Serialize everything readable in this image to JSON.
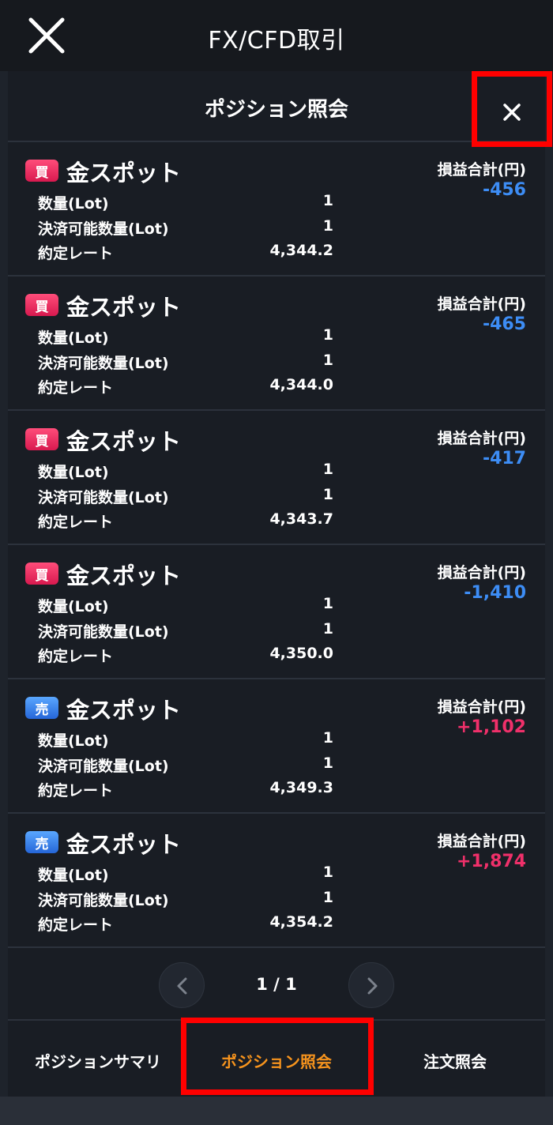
{
  "app": {
    "title": "FX/CFD取引"
  },
  "modal": {
    "title": "ポジション照会"
  },
  "positions": [
    {
      "side": "買",
      "side_type": "buy",
      "instrument": "金スポット",
      "qty_label": "数量(Lot)",
      "qty": "1",
      "settle_label": "決済可能数量(Lot)",
      "settle": "1",
      "rate_label": "約定レート",
      "rate": "4,344.2",
      "pl_label": "損益合計(円)",
      "pl": "-456"
    },
    {
      "side": "買",
      "side_type": "buy",
      "instrument": "金スポット",
      "qty_label": "数量(Lot)",
      "qty": "1",
      "settle_label": "決済可能数量(Lot)",
      "settle": "1",
      "rate_label": "約定レート",
      "rate": "4,344.0",
      "pl_label": "損益合計(円)",
      "pl": "-465"
    },
    {
      "side": "買",
      "side_type": "buy",
      "instrument": "金スポット",
      "qty_label": "数量(Lot)",
      "qty": "1",
      "settle_label": "決済可能数量(Lot)",
      "settle": "1",
      "rate_label": "約定レート",
      "rate": "4,343.7",
      "pl_label": "損益合計(円)",
      "pl": "-417"
    },
    {
      "side": "買",
      "side_type": "buy",
      "instrument": "金スポット",
      "qty_label": "数量(Lot)",
      "qty": "1",
      "settle_label": "決済可能数量(Lot)",
      "settle": "1",
      "rate_label": "約定レート",
      "rate": "4,350.0",
      "pl_label": "損益合計(円)",
      "pl": "-1,410"
    },
    {
      "side": "売",
      "side_type": "sell",
      "instrument": "金スポット",
      "qty_label": "数量(Lot)",
      "qty": "1",
      "settle_label": "決済可能数量(Lot)",
      "settle": "1",
      "rate_label": "約定レート",
      "rate": "4,349.3",
      "pl_label": "損益合計(円)",
      "pl": "+1,102"
    },
    {
      "side": "売",
      "side_type": "sell",
      "instrument": "金スポット",
      "qty_label": "数量(Lot)",
      "qty": "1",
      "settle_label": "決済可能数量(Lot)",
      "settle": "1",
      "rate_label": "約定レート",
      "rate": "4,354.2",
      "pl_label": "損益合計(円)",
      "pl": "+1,874"
    }
  ],
  "pagination": {
    "text": "1 / 1"
  },
  "tabs": [
    {
      "label": "ポジションサマリ",
      "active": false
    },
    {
      "label": "ポジション照会",
      "active": true
    },
    {
      "label": "注文照会",
      "active": false
    }
  ],
  "colors": {
    "loss": "#3d8df5",
    "profit": "#f0306a",
    "active_tab": "#f7941d",
    "highlight": "#ff0000"
  },
  "icons": {
    "app_close": "close-icon",
    "modal_close": "close-icon",
    "prev": "chevron-left-icon",
    "next": "chevron-right-icon"
  }
}
